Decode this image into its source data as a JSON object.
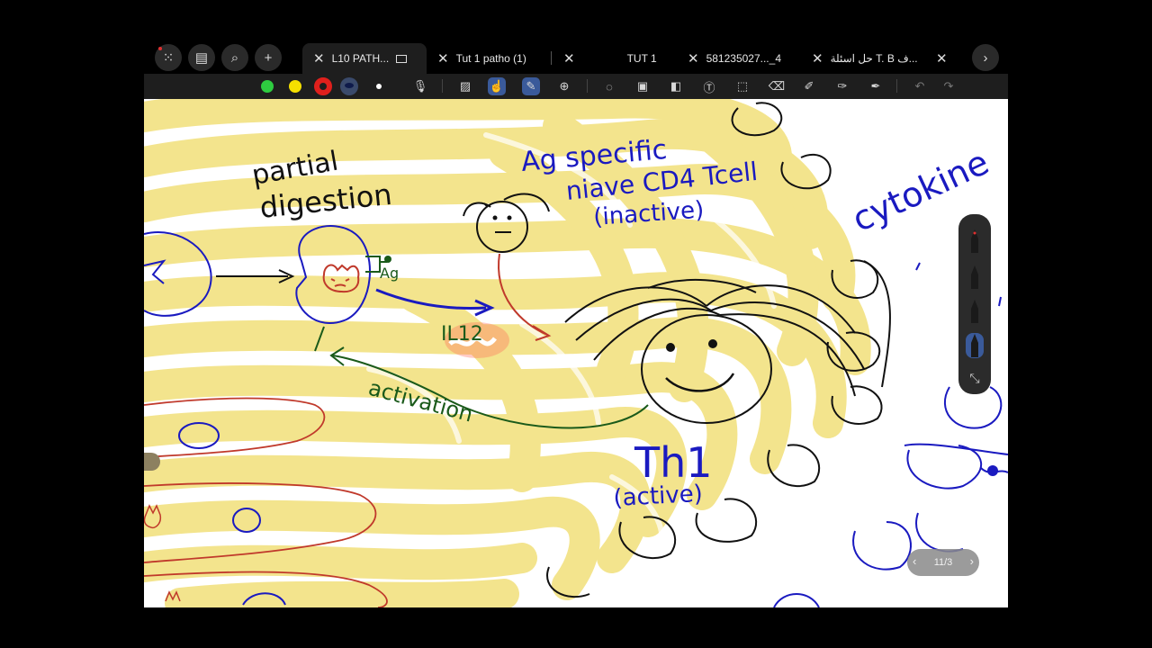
{
  "tabs": [
    {
      "label": "L10 PATH..."
    },
    {
      "label": "Tut 1 patho (1)"
    },
    {
      "label": "TUT 1"
    },
    {
      "label": "581235027..._4"
    },
    {
      "label": "حل اسئلة T. B ف..."
    }
  ],
  "toolbar": {
    "colors": [
      "#2ecc40",
      "#f5e000",
      "#e0201c",
      "#1a2b6b",
      "#ffffff"
    ],
    "icons": [
      "microphone-icon",
      "texture-icon",
      "touch-draw-icon",
      "stylus-icon",
      "zoom-icon",
      "lasso-icon",
      "image-icon",
      "shapes-icon",
      "text-icon",
      "selection-icon",
      "eraser-icon",
      "pen-icon",
      "highlighter-icon",
      "marker-icon",
      "undo-icon",
      "redo-icon"
    ]
  },
  "notes": {
    "partial": "partial",
    "digestion": "digestion",
    "ag_specific": "Ag specific",
    "niave": "niave CD4 Tcell",
    "inactive": "(inactive)",
    "cytokine": "cytokine",
    "ag_small": "Ag",
    "il12": "IL12",
    "activation": "activation",
    "th1": "Th1",
    "active": "(active)"
  },
  "pen_palette": {
    "pens": [
      "pen-black-1",
      "pen-black-2",
      "pen-black-3",
      "pen-blue-selected"
    ]
  },
  "page_indicator": {
    "text": "11/3"
  },
  "highlight_color": "#f2e07a"
}
